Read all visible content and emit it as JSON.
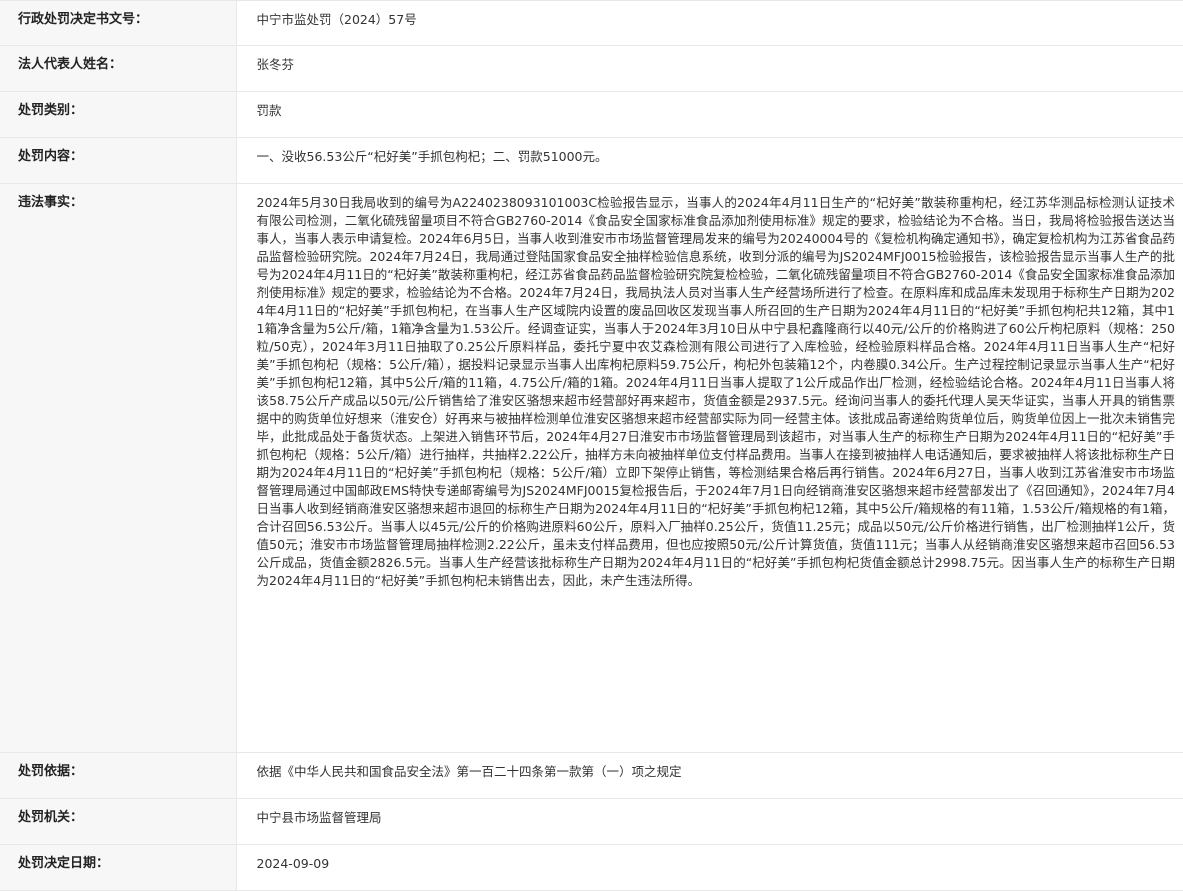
{
  "rows": [
    {
      "label": "行政处罚决定书文号：",
      "value": "中宁市监处罚（2024）57号"
    },
    {
      "label": "法人代表人姓名：",
      "value": "张冬芬"
    },
    {
      "label": "处罚类别：",
      "value": "罚款"
    },
    {
      "label": "处罚内容：",
      "value": "一、没收56.53公斤“杞好美”手抓包枸杞；二、罚款51000元。"
    },
    {
      "label": "违法事实：",
      "value": "2024年5月30日我局收到的编号为A2240238093101003C检验报告显示，当事人的2024年4月11日生产的“杞好美”散装称重枸杞，经江苏华测品标检测认证技术有限公司检测，二氧化硫残留量项目不符合GB2760-2014《食品安全国家标准食品添加剂使用标准》规定的要求，检验结论为不合格。当日，我局将检验报告送达当事人，当事人表示申请复检。2024年6月5日，当事人收到淮安市市场监督管理局发来的编号为20240004号的《复检机构确定通知书》，确定复检机构为江苏省食品药品监督检验研究院。2024年7月24日，我局通过登陆国家食品安全抽样检验信息系统，收到分派的编号为JS2024MFJ0015检验报告，该检验报告显示当事人生产的批号为2024年4月11日的“杞好美”散装称重枸杞，经江苏省食品药品监督检验研究院复检检验，二氧化硫残留量项目不符合GB2760-2014《食品安全国家标准食品添加剂使用标准》规定的要求，检验结论为不合格。2024年7月24日，我局执法人员对当事人生产经营场所进行了检查。在原料库和成品库未发现用于标称生产日期为2024年4月11日的“杞好美”手抓包枸杞，在当事人生产区域院内设置的废品回收区发现当事人所召回的生产日期为2024年4月11日的“杞好美”手抓包枸杞共12箱，其中11箱净含量为5公斤/箱，1箱净含量为1.53公斤。经调查证实，当事人于2024年3月10日从中宁县杞鑫隆商行以40元/公斤的价格购进了60公斤枸杞原料（规格：250粒/50克），2024年3月11日抽取了0.25公斤原料样品，委托宁夏中农艾森检测有限公司进行了入库检验，经检验原料样品合格。2024年4月11日当事人生产“杞好美”手抓包枸杞（规格：5公斤/箱），据投料记录显示当事人出库枸杞原料59.75公斤，枸杞外包装箱12个，内卷膜0.34公斤。生产过程控制记录显示当事人生产“杞好美”手抓包枸杞12箱，其中5公斤/箱的11箱，4.75公斤/箱的1箱。2024年4月11日当事人提取了1公斤成品作出厂检测，经检验结论合格。2024年4月11日当事人将该58.75公斤产成品以50元/公斤销售给了淮安区骆想来超市经营部好再来超市，货值金额是2937.5元。经询问当事人的委托代理人吴天华证实，当事人开具的销售票据中的购货单位好想来（淮安仓）好再来与被抽样检测单位淮安区骆想来超市经营部实际为同一经营主体。该批成品寄递给购货单位后，购货单位因上一批次未销售完毕，此批成品处于备货状态。上架进入销售环节后，2024年4月27日淮安市市场监督管理局到该超市，对当事人生产的标称生产日期为2024年4月11日的“杞好美”手抓包枸杞（规格：5公斤/箱）进行抽样，共抽样2.22公斤，抽样方未向被抽样单位支付样品费用。当事人在接到被抽样人电话通知后，要求被抽样人将该批标称生产日期为2024年4月11日的“杞好美”手抓包枸杞（规格：5公斤/箱）立即下架停止销售，等检测结果合格后再行销售。2024年6月27日，当事人收到江苏省淮安市市场监督管理局通过中国邮政EMS特快专递邮寄编号为JS2024MFJ0015复检报告后，于2024年7月1日向经销商淮安区骆想来超市经营部发出了《召回通知》，2024年7月4日当事人收到经销商淮安区骆想来超市退回的标称生产日期为2024年4月11日的“杞好美”手抓包枸杞12箱，其中5公斤/箱规格的有11箱，1.53公斤/箱规格的有1箱，合计召回56.53公斤。当事人以45元/公斤的价格购进原料60公斤，原料入厂抽样0.25公斤，货值11.25元；成品以50元/公斤价格进行销售，出厂检测抽样1公斤，货值50元；淮安市市场监督管理局抽样检测2.22公斤，虽未支付样品费用，但也应按照50元/公斤计算货值，货值111元；当事人从经销商淮安区骆想来超市召回56.53公斤成品，货值金额2826.5元。当事人生产经营该批标称生产日期为2024年4月11日的“杞好美”手抓包枸杞货值金额总计2998.75元。因当事人生产的标称生产日期为2024年4月11日的“杞好美”手抓包枸杞未销售出去，因此，未产生违法所得。"
    },
    {
      "label": "处罚依据：",
      "value": "依据《中华人民共和国食品安全法》第一百二十四条第一款第（一）项之规定"
    },
    {
      "label": "处罚机关：",
      "value": "中宁县市场监督管理局"
    },
    {
      "label": "处罚决定日期：",
      "value": "2024-09-09"
    }
  ]
}
